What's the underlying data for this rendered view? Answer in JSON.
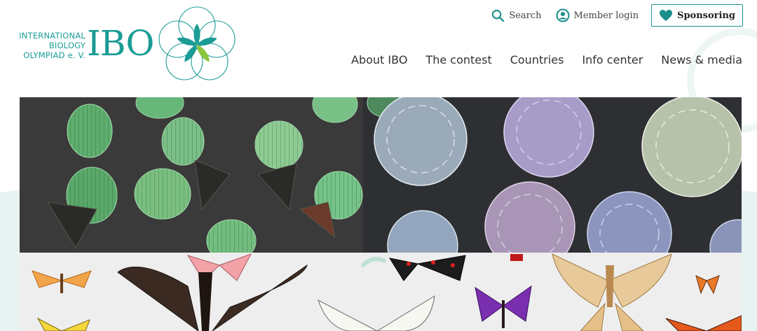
{
  "logo": {
    "lines": [
      "INTERNATIONAL",
      "BIOLOGY",
      "OLYMPIAD e. V."
    ],
    "abbr": "IBO"
  },
  "utility_nav": {
    "search": "Search",
    "login": "Member login",
    "sponsoring": "Sponsoring"
  },
  "main_nav": [
    "About IBO",
    "The contest",
    "Countries",
    "Info center",
    "News & media"
  ],
  "colors": {
    "brand_teal": "#1a9c95",
    "leaf_green": "#8cc63f",
    "hero_dark": "#3a3a3a",
    "hero_light": "#eeeeee"
  },
  "icons": {
    "search": "search-icon",
    "login": "user-circle-icon",
    "sponsoring": "heart-icon"
  }
}
